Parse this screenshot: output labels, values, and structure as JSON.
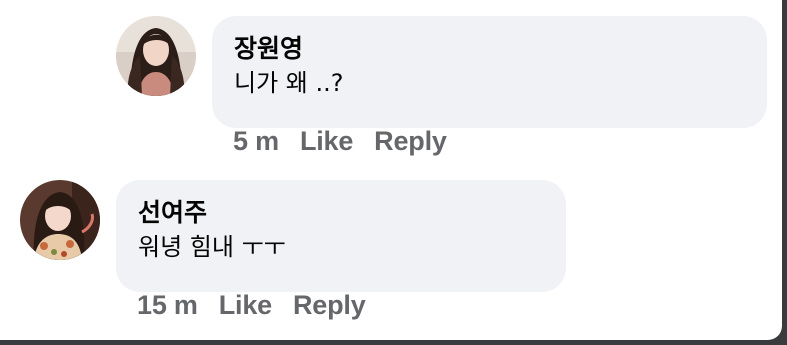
{
  "comments": [
    {
      "author": "장원영",
      "text": "니가 왜 ..?",
      "time": "5 m",
      "like_label": "Like",
      "reply_label": "Reply"
    },
    {
      "author": "선여주",
      "text": "워녕 힘내 ㅜㅜ",
      "time": "15 m",
      "like_label": "Like",
      "reply_label": "Reply"
    }
  ],
  "colors": {
    "bubble": "#f0f2f5",
    "author_text": "#050505",
    "meta_text": "#65676b"
  }
}
